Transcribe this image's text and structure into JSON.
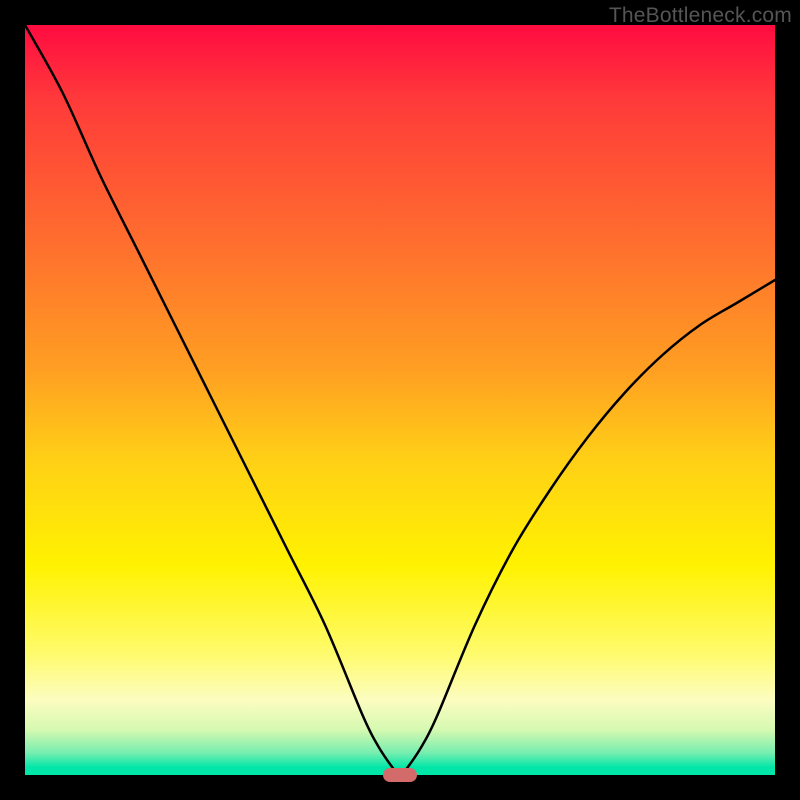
{
  "watermark": "TheBottleneck.com",
  "chart_data": {
    "type": "line",
    "title": "",
    "xlabel": "",
    "ylabel": "",
    "xlim": [
      0,
      100
    ],
    "ylim": [
      0,
      100
    ],
    "background_gradient": {
      "direction": "vertical",
      "stops": [
        {
          "pos": 0.0,
          "color": "#ff0b41"
        },
        {
          "pos": 0.1,
          "color": "#ff3a3a"
        },
        {
          "pos": 0.29,
          "color": "#ff6e2e"
        },
        {
          "pos": 0.46,
          "color": "#ff9f22"
        },
        {
          "pos": 0.58,
          "color": "#ffd016"
        },
        {
          "pos": 0.72,
          "color": "#fff200"
        },
        {
          "pos": 0.84,
          "color": "#fffb6e"
        },
        {
          "pos": 0.9,
          "color": "#fcfdc0"
        },
        {
          "pos": 0.94,
          "color": "#d5f9b1"
        },
        {
          "pos": 0.97,
          "color": "#78eeb0"
        },
        {
          "pos": 0.99,
          "color": "#00e6a8"
        },
        {
          "pos": 1.0,
          "color": "#00e6a8"
        }
      ]
    },
    "series": [
      {
        "name": "bottleneck-curve",
        "color": "#000000",
        "x": [
          0,
          5,
          10,
          15,
          20,
          25,
          30,
          35,
          40,
          45,
          47,
          49,
          50,
          51,
          53,
          55,
          60,
          65,
          70,
          75,
          80,
          85,
          90,
          95,
          100
        ],
        "y": [
          100,
          91,
          80,
          70,
          60,
          50,
          40,
          30,
          20,
          8,
          4,
          1,
          0,
          1,
          4,
          8,
          20,
          30,
          38,
          45,
          51,
          56,
          60,
          63,
          66
        ]
      }
    ],
    "annotations": [
      {
        "name": "minimum-marker",
        "shape": "pill",
        "color": "#d46b6b",
        "x": 50,
        "y": 0
      }
    ]
  }
}
